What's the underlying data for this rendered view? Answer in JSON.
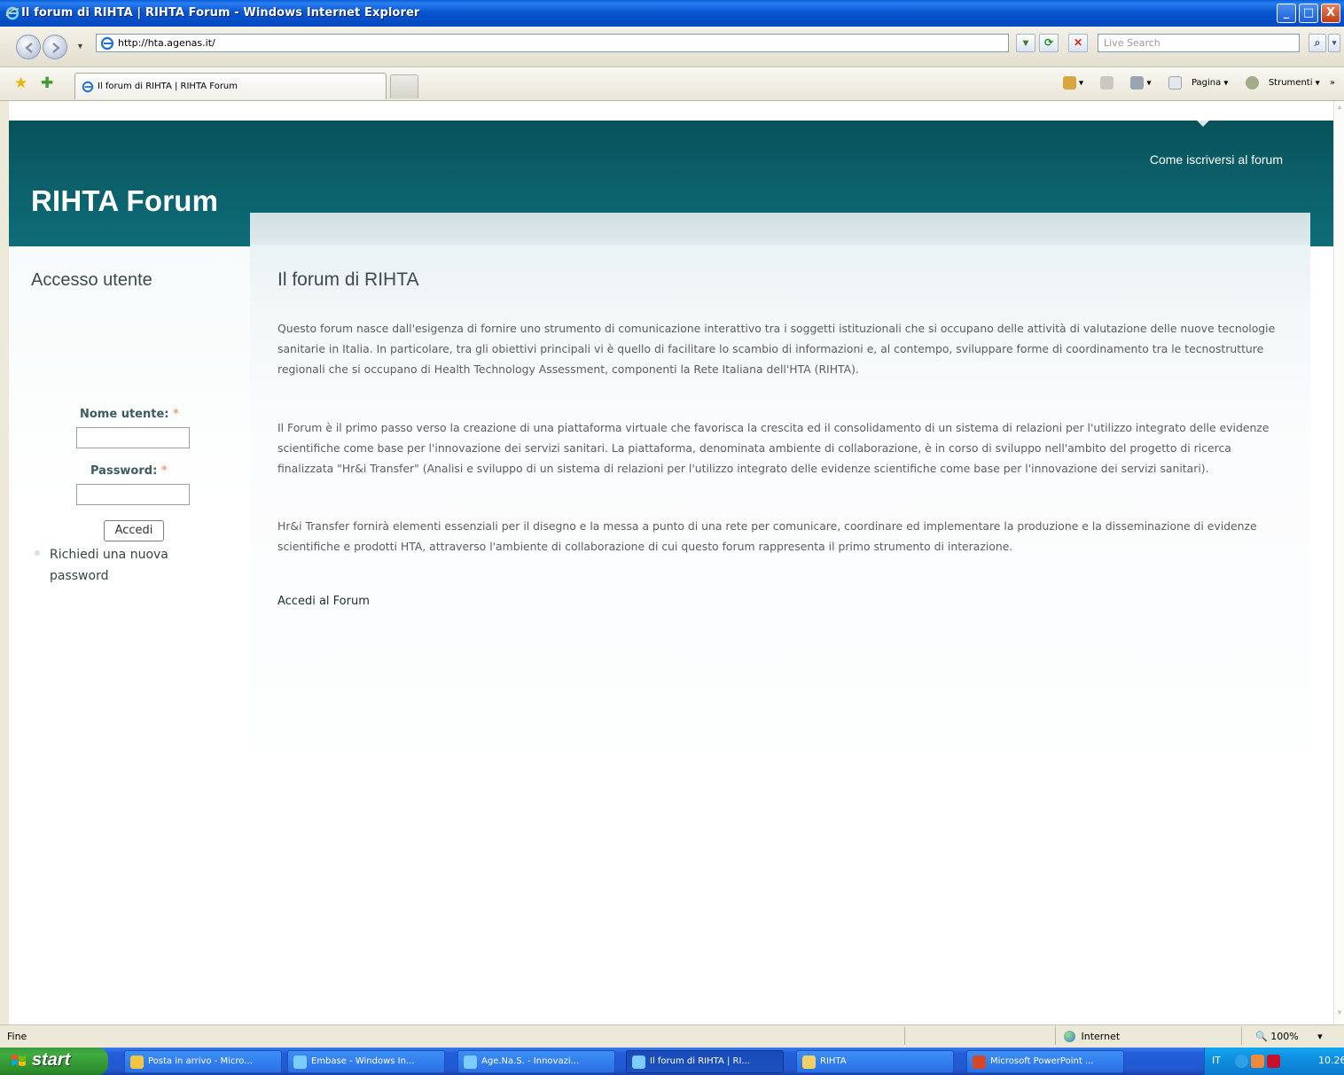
{
  "window": {
    "title": "Il forum di RIHTA | RIHTA Forum - Windows Internet Explorer",
    "minimize": "_",
    "maximize": "□",
    "close": "X"
  },
  "addressbar": {
    "url": "http://hta.agenas.it/",
    "search_placeholder": "Live Search"
  },
  "tab": {
    "label": "Il forum di RIHTA | RIHTA Forum"
  },
  "commandbar": {
    "home": "",
    "feeds": "",
    "print": "",
    "page": "Pagina",
    "tools": "Strumenti",
    "more": "»"
  },
  "site": {
    "name": "RIHTA Forum",
    "header_link": "Come iscriversi al forum"
  },
  "login": {
    "title": "Accesso utente",
    "username_label": "Nome utente:",
    "password_label": "Password:",
    "required_marker": "*",
    "submit": "Accedi",
    "request_password": "Richiedi una nuova password"
  },
  "main": {
    "title": "Il forum di RIHTA",
    "paragraphs": [
      "Questo forum nasce dall'esigenza di fornire uno strumento di comunicazione interattivo tra i soggetti istituzionali che si occupano delle attività di valutazione delle nuove tecnologie sanitarie in Italia. In particolare, tra gli obiettivi principali vi è quello di facilitare lo scambio di informazioni e, al contempo, sviluppare forme di coordinamento tra le tecnostrutture regionali che si occupano di Health Technology Assessment, componenti la Rete Italiana dell'HTA (RIHTA).",
      "Il Forum è il primo passo verso la creazione di una piattaforma virtuale che favorisca la crescita ed il consolidamento di un sistema di relazioni per l'utilizzo integrato delle evidenze scientifiche come base per l'innovazione dei servizi sanitari. La piattaforma, denominata ambiente di collaborazione, è in corso di sviluppo nell'ambito del progetto di ricerca finalizzata \"Hr&i Transfer\" (Analisi e sviluppo di un sistema di relazioni per l'utilizzo integrato delle evidenze scientifiche come base per l'innovazione dei servizi sanitari).",
      "Hr&i Transfer fornirà elementi essenziali per il disegno e la messa a punto di una rete per comunicare, coordinare ed implementare la produzione e la disseminazione di evidenze scientifiche e prodotti HTA, attraverso l'ambiente di collaborazione di cui questo forum rappresenta il primo strumento di interazione."
    ],
    "forum_link": "Accedi al Forum"
  },
  "statusbar": {
    "status": "Fine",
    "zone": "Internet",
    "zoom": "100%"
  },
  "taskbar": {
    "start": "start",
    "tasks": [
      "Posta in arrivo - Micro...",
      "Embase - Windows In...",
      "Age.Na.S. - Innovazi...",
      "Il forum di RIHTA | RI...",
      "RIHTA",
      "Microsoft PowerPoint ..."
    ],
    "language": "IT",
    "clock": "10.26"
  }
}
